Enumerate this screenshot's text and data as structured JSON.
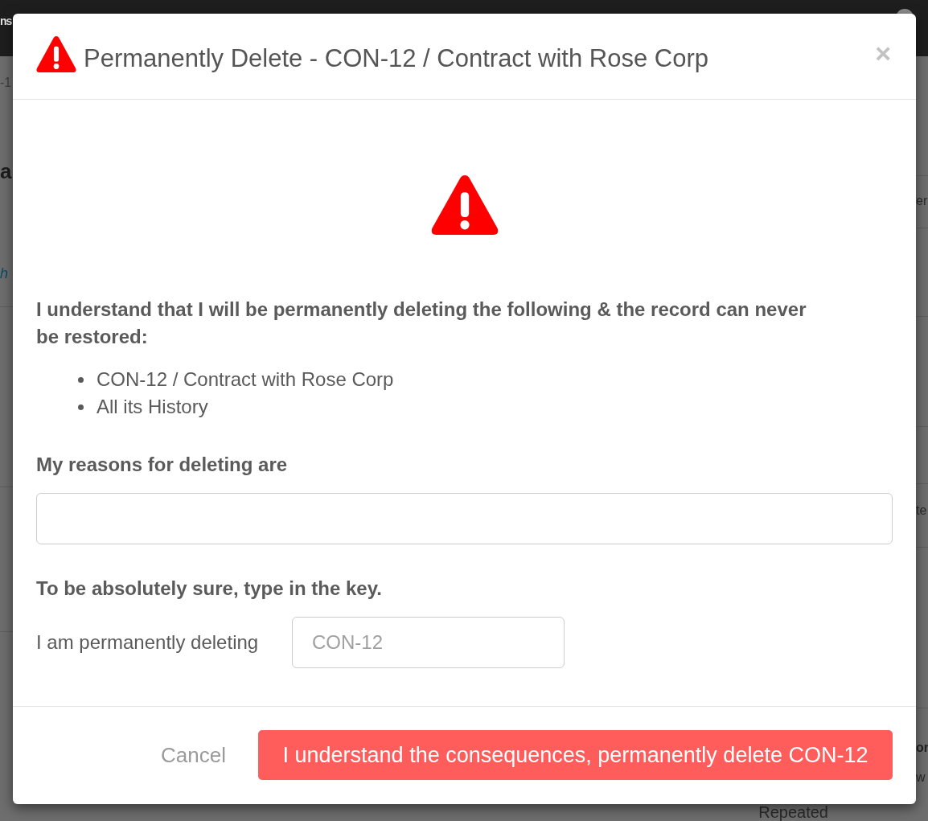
{
  "background": {
    "top_bar": {
      "text": "ns"
    },
    "left_fragments": [
      {
        "kind": "crumb",
        "text": "-1"
      },
      {
        "kind": "heading",
        "text": "a"
      },
      {
        "kind": "link",
        "text": "h"
      }
    ],
    "right_fragments": [
      {
        "kind": "cell",
        "text": "er"
      },
      {
        "kind": "cell",
        "text": "te"
      },
      {
        "kind": "strong",
        "text": "or"
      },
      {
        "kind": "cell",
        "text": "w"
      }
    ],
    "bottom_fragment": "Repeated"
  },
  "dialog": {
    "title": "Permanently Delete - CON-12 / Contract with Rose Corp",
    "close": "×",
    "warning": "I understand that I will be permanently deleting the following & the record can never be restored:",
    "items": [
      "CON-12 / Contract with Rose Corp",
      "All its History"
    ],
    "reason_label": "My reasons for deleting are",
    "confirm_heading": "To be absolutely sure, type in the key.",
    "key_label": "I am permanently deleting",
    "key_field": {
      "placeholder": "CON-12"
    },
    "buttons": [
      {
        "kind": "link",
        "label": "Cancel"
      },
      {
        "kind": "danger",
        "label": "I understand the consequences, permanently delete CON-12"
      }
    ]
  }
}
